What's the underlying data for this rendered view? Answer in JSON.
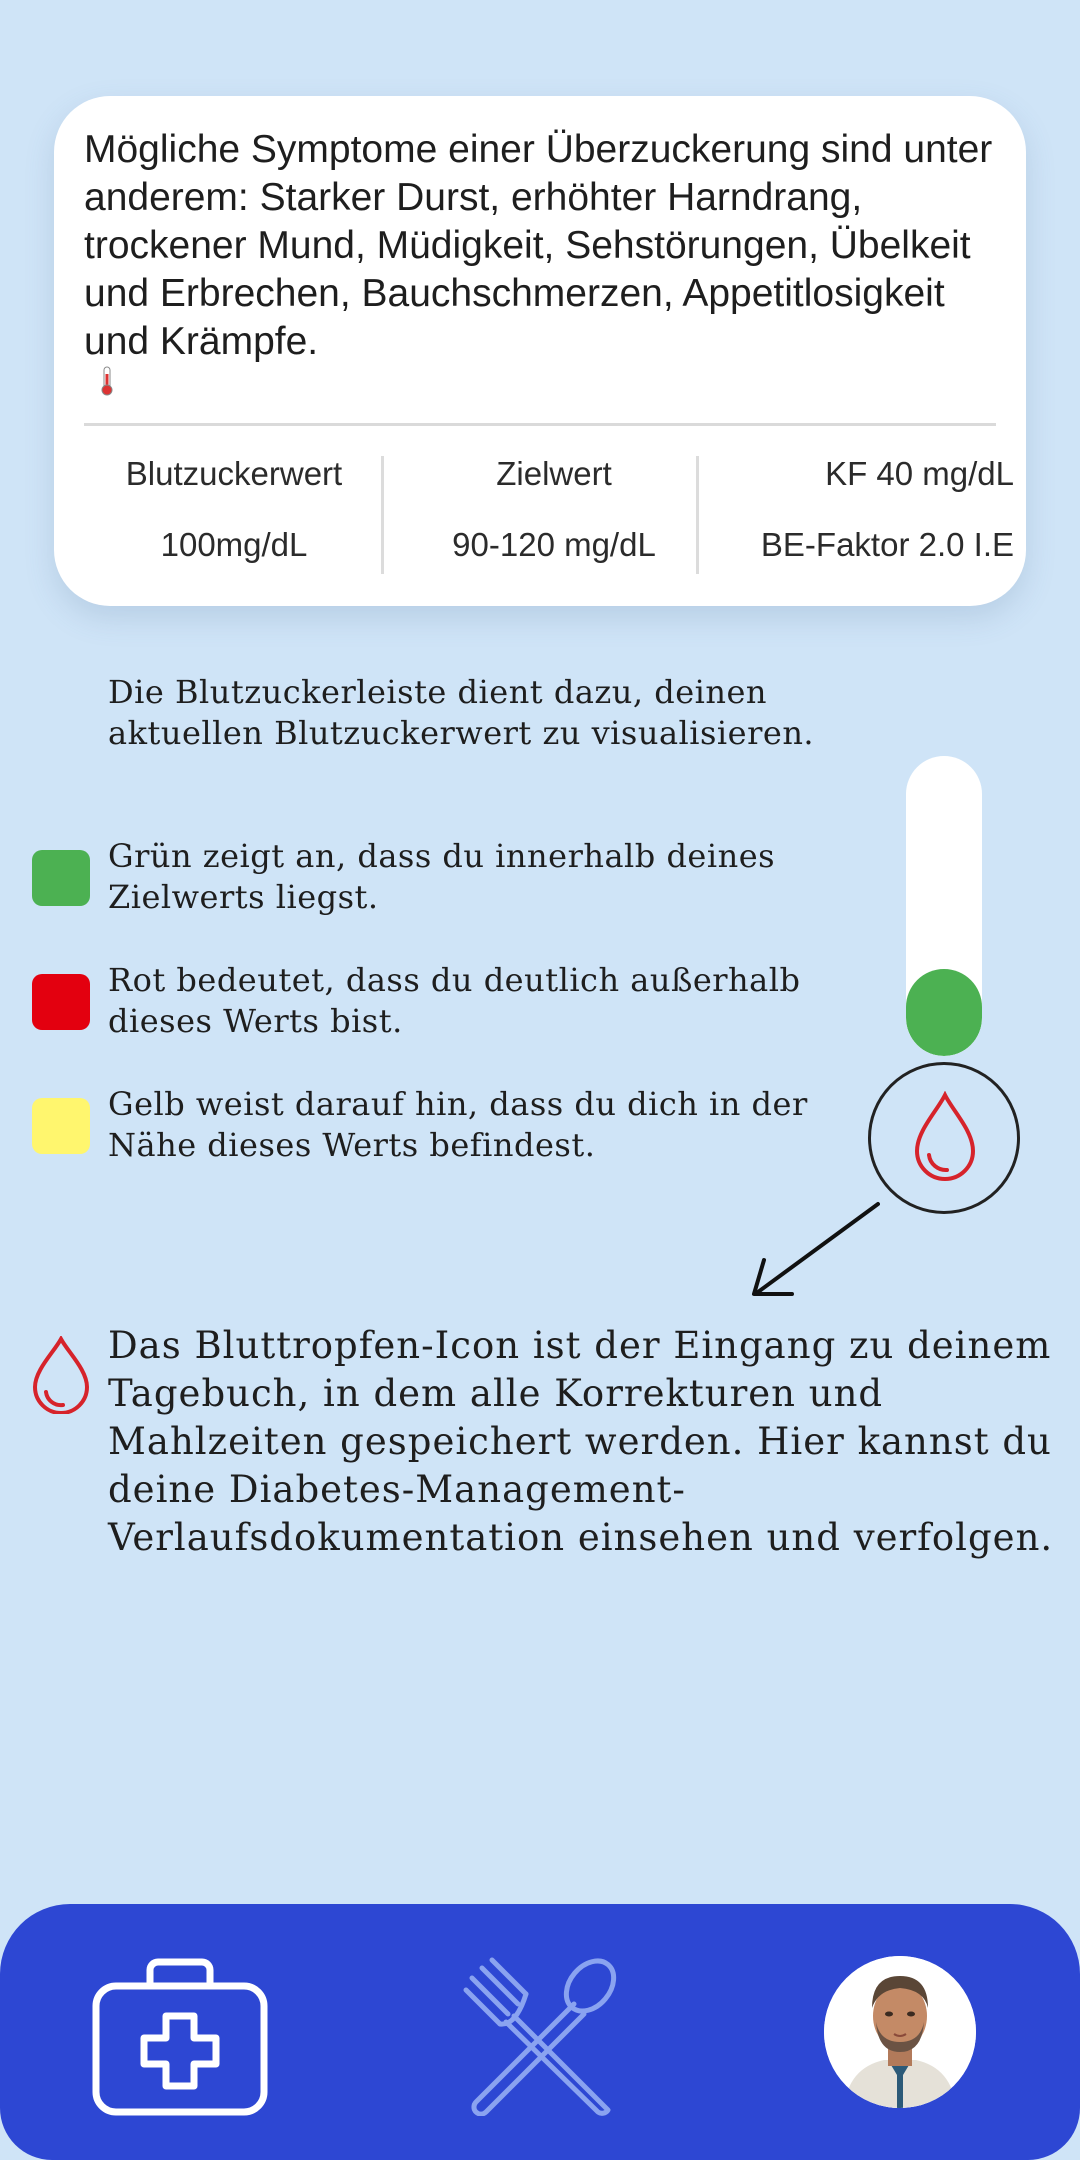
{
  "info_card": {
    "symptoms_text": "Mögliche Symptome einer Überzuckerung sind unter anderem: Starker Durst, erhöhter Harndrang, trockener Mund, Müdigkeit, Sehstörungen, Übelkeit und Erbrechen, Bauchschmerzen, Appetitlosigkeit und Krämpfe.",
    "stats": {
      "blood_sugar_label": "Blutzuckerwert",
      "blood_sugar_value": "100mg/dL",
      "target_label": "Zielwert",
      "target_value": "90-120 mg/dL",
      "kf_label": "KF 40 mg/dL",
      "be_factor_label": "BE-Faktor 2.0 I.E"
    }
  },
  "legend": {
    "intro": "Die Blutzuckerleiste dient dazu, deinen aktuellen Blutzuckerwert zu visualisieren.",
    "items": [
      {
        "color": "#4cb152",
        "text": "Grün zeigt an, dass du innerhalb deines Zielwerts liegst."
      },
      {
        "color": "#e3000f",
        "text": "Rot bedeutet, dass du deutlich außerhalb dieses Werts bist."
      },
      {
        "color": "#fff66e",
        "text": "Gelb weist darauf hin, dass du dich in der Nähe dieses Werts befindest."
      }
    ]
  },
  "meter": {
    "level": 0.29,
    "fill_color": "#4cb152"
  },
  "drop_description": "Das Bluttropfen-Icon ist der Eingang zu deinem Tagebuch, in dem alle Korrekturen und Mahlzeiten gespeichert werden. Hier kannst du deine Diabetes-Management-Verlaufsdokumentation einsehen und verfolgen.",
  "bottom_nav": {
    "items": [
      {
        "icon": "first-aid-kit-icon"
      },
      {
        "icon": "fork-spoon-icon"
      },
      {
        "icon": "avatar"
      }
    ],
    "background": "#2d47d3"
  }
}
